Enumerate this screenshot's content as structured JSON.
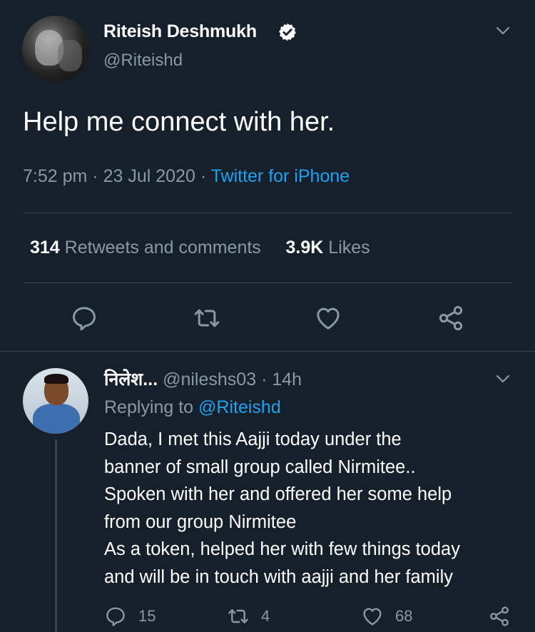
{
  "tweet": {
    "author_name": "Riteish Deshmukh",
    "author_handle": "@Riteishd",
    "text": "Help me connect with her.",
    "time": "7:52 pm",
    "date": "23 Jul 2020",
    "separator": "·",
    "source": "Twitter for iPhone",
    "retweets_count": "314",
    "retweets_label": "Retweets and comments",
    "likes_count": "3.9K",
    "likes_label": "Likes",
    "actions": [
      "reply-icon",
      "retweet-icon",
      "like-icon",
      "share-icon"
    ]
  },
  "reply": {
    "author_name": "निलेश...",
    "author_handle": "@nileshs03",
    "separator": "·",
    "time_ago": "14h",
    "replying_prefix": "Replying to",
    "replying_to": "@Riteishd",
    "text_lines": [
      "Dada,  I met this Aajji today under the",
      "banner of small group called Nirmitee..",
      "Spoken with her and offered her some help",
      "from our group Nirmitee",
      "As a token, helped her with few things today",
      "and will be in touch with aajji and her family"
    ],
    "reply_count": "15",
    "retweet_count": "4",
    "like_count": "68"
  },
  "colors": {
    "background": "#15202b",
    "text": "#ffffff",
    "secondary": "#8899a6",
    "accent": "#1da1f2",
    "divider": "#38444d"
  }
}
